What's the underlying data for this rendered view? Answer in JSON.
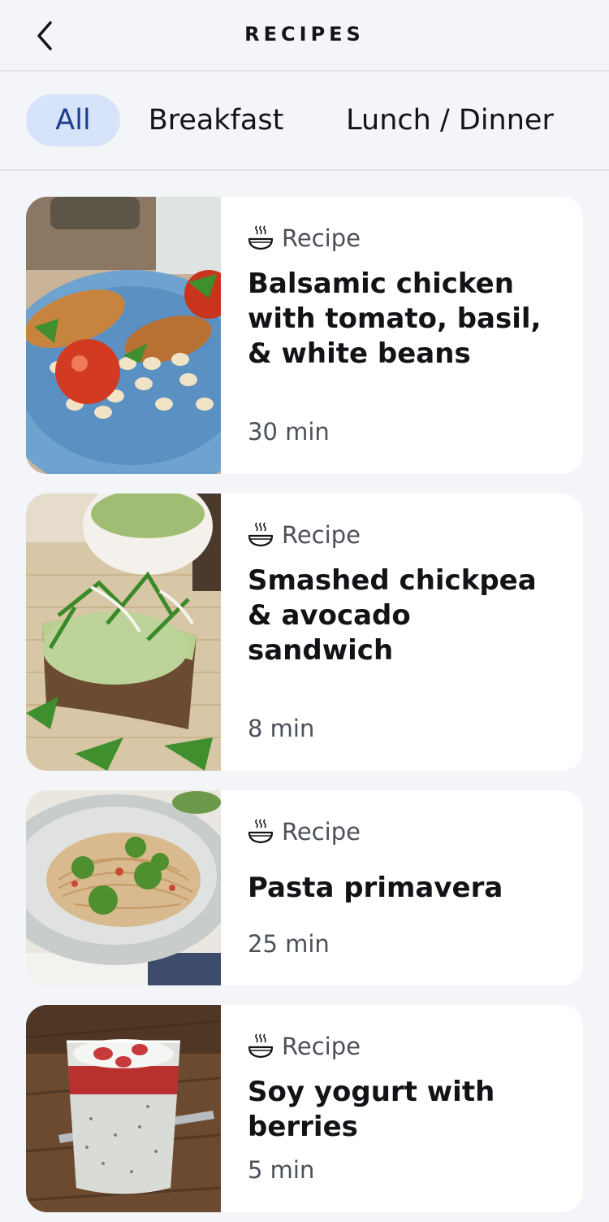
{
  "header": {
    "title": "RECIPES",
    "back_icon": "chevron-left-icon"
  },
  "filters": [
    {
      "label": "All",
      "active": true
    },
    {
      "label": "Breakfast",
      "active": false
    },
    {
      "label": "Lunch / Dinner",
      "active": false
    }
  ],
  "colors": {
    "background": "#f3f5f9",
    "card": "#ffffff",
    "active_chip_bg": "#d6e3f8",
    "active_chip_text": "#1e3d8c",
    "secondary_text": "#4b5059"
  },
  "recipes": [
    {
      "tag": "Recipe",
      "tag_icon": "steaming-bowl-icon",
      "title": "Balsamic chicken with tomato, basil, & white beans",
      "duration": "30 min",
      "image": "chicken-beans-plate-image"
    },
    {
      "tag": "Recipe",
      "tag_icon": "steaming-bowl-icon",
      "title": "Smashed chickpea & avocado sandwich",
      "duration": "8 min",
      "image": "chickpea-avocado-toast-image"
    },
    {
      "tag": "Recipe",
      "tag_icon": "steaming-bowl-icon",
      "title": "Pasta primavera",
      "duration": "25 min",
      "image": "pasta-broccoli-plate-image"
    },
    {
      "tag": "Recipe",
      "tag_icon": "steaming-bowl-icon",
      "title": "Soy yogurt with berries",
      "duration": "5 min",
      "image": "yogurt-berries-glass-image"
    }
  ]
}
